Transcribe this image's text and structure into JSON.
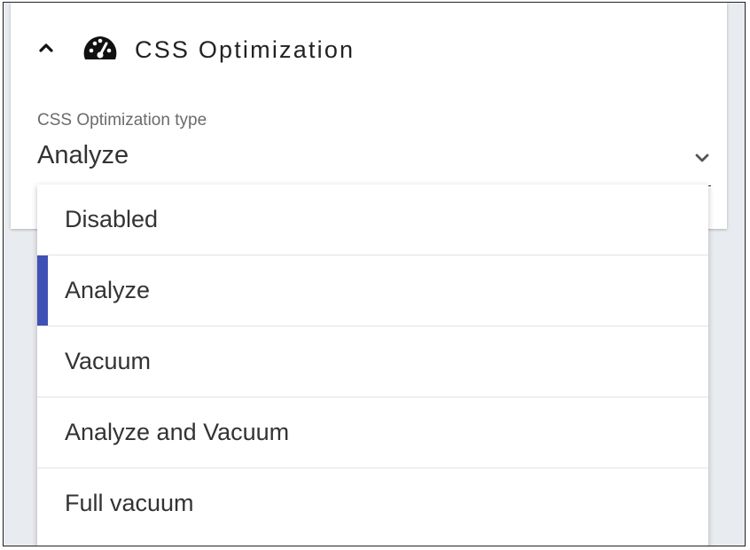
{
  "panel": {
    "title": "CSS Optimization",
    "collapse_icon": "chevron-up-icon",
    "title_icon": "gauge-icon"
  },
  "field": {
    "label": "CSS Optimization type",
    "value": "Analyze",
    "dropdown_icon": "chevron-down-icon"
  },
  "menu": {
    "items": [
      {
        "label": "Disabled",
        "selected": false
      },
      {
        "label": "Analyze",
        "selected": true
      },
      {
        "label": "Vacuum",
        "selected": false
      },
      {
        "label": "Analyze and Vacuum",
        "selected": false
      },
      {
        "label": "Full vacuum",
        "selected": false
      }
    ]
  },
  "colors": {
    "accent": "#3f51b5",
    "background": "#e8ebef",
    "text": "#333333",
    "label": "#6b6b6b"
  }
}
